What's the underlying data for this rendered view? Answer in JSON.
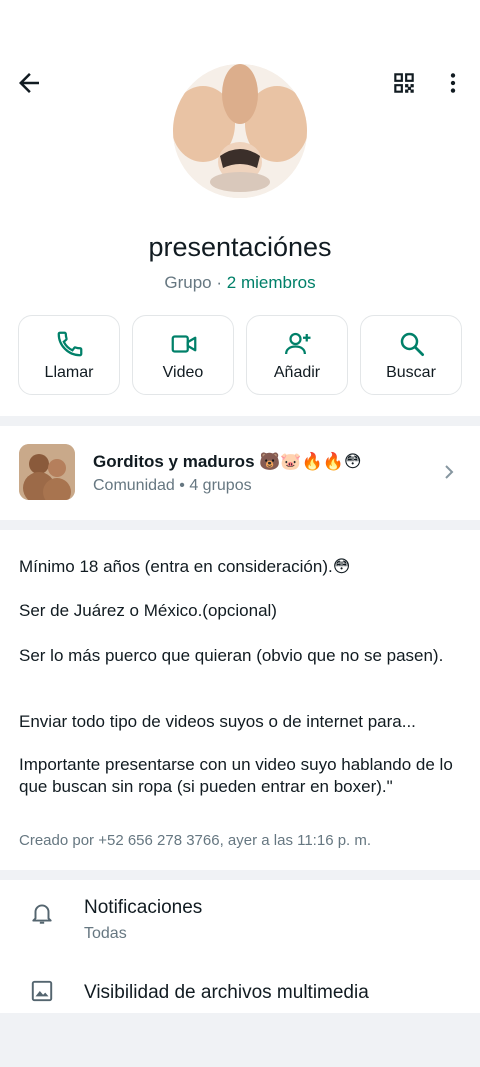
{
  "header": {
    "back_icon": "arrow-left-icon",
    "qr_icon": "qr-code-icon",
    "menu_icon": "more-vert-icon"
  },
  "group": {
    "name": "presentaciónes",
    "type": "Grupo",
    "separator": "·",
    "members": "2 miembros"
  },
  "actions": [
    {
      "label": "Llamar",
      "icon": "phone-icon"
    },
    {
      "label": "Video",
      "icon": "video-icon"
    },
    {
      "label": "Añadir",
      "icon": "add-person-icon"
    },
    {
      "label": "Buscar",
      "icon": "search-icon"
    }
  ],
  "community": {
    "name": "Gorditos y maduros 🐻🐷🔥🔥😳",
    "subtitle": "Comunidad • 4 grupos"
  },
  "description": {
    "lines": [
      "Mínimo 18 años (entra en consideración).😳",
      "Ser de Juárez o México.(opcional)",
      "Ser lo más puerco que quieran (obvio que no se pasen).",
      "Enviar todo tipo de videos suyos o de internet para...",
      "Importante presentarse con un video suyo hablando de lo que buscan sin ropa (si pueden entrar en boxer).\""
    ],
    "created": "Creado por +52 656 278 3766, ayer a las 11:16 p. m."
  },
  "settings": [
    {
      "title": "Notificaciones",
      "subtitle": "Todas",
      "icon": "bell-icon"
    },
    {
      "title": "Visibilidad de archivos multimedia",
      "icon": "image-icon"
    }
  ],
  "colors": {
    "accent": "#008069",
    "text": "#111b21",
    "muted": "#667781",
    "background": "#f0f2f5"
  }
}
